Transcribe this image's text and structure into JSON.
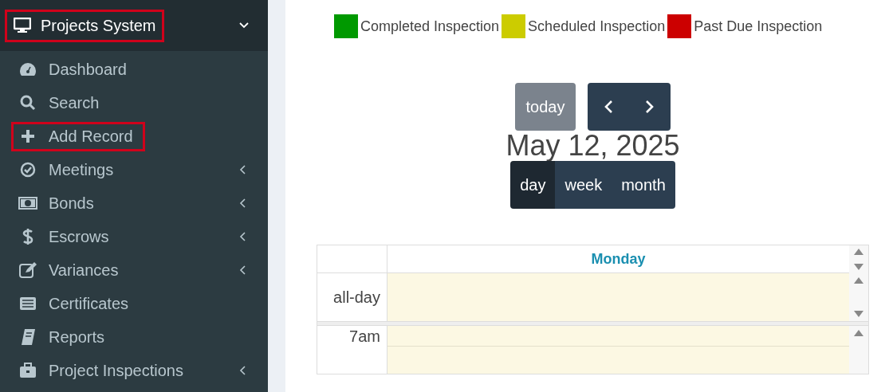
{
  "sidebar": {
    "header": {
      "title": "Projects System",
      "highlighted": true,
      "expanded": true
    },
    "items": [
      {
        "label": "Dashboard",
        "has_submenu": false,
        "highlighted": false
      },
      {
        "label": "Search",
        "has_submenu": false,
        "highlighted": false
      },
      {
        "label": "Add Record",
        "has_submenu": false,
        "highlighted": true
      },
      {
        "label": "Meetings",
        "has_submenu": true,
        "highlighted": false
      },
      {
        "label": "Bonds",
        "has_submenu": true,
        "highlighted": false
      },
      {
        "label": "Escrows",
        "has_submenu": true,
        "highlighted": false
      },
      {
        "label": "Variances",
        "has_submenu": true,
        "highlighted": false
      },
      {
        "label": "Certificates",
        "has_submenu": false,
        "highlighted": false
      },
      {
        "label": "Reports",
        "has_submenu": false,
        "highlighted": false
      },
      {
        "label": "Project Inspections",
        "has_submenu": true,
        "highlighted": false
      }
    ]
  },
  "legend": [
    {
      "label": "Completed Inspection",
      "color": "#009900"
    },
    {
      "label": "Scheduled Inspection",
      "color": "#cccc00"
    },
    {
      "label": "Past Due Inspection",
      "color": "#cc0000"
    }
  ],
  "calendar": {
    "today_button": "today",
    "title": "May 12, 2025",
    "views": [
      {
        "label": "day",
        "selected": true
      },
      {
        "label": "week",
        "selected": false
      },
      {
        "label": "month",
        "selected": false
      }
    ],
    "day_header": "Monday",
    "all_day_label": "all-day",
    "time_slots": [
      "7am"
    ]
  }
}
